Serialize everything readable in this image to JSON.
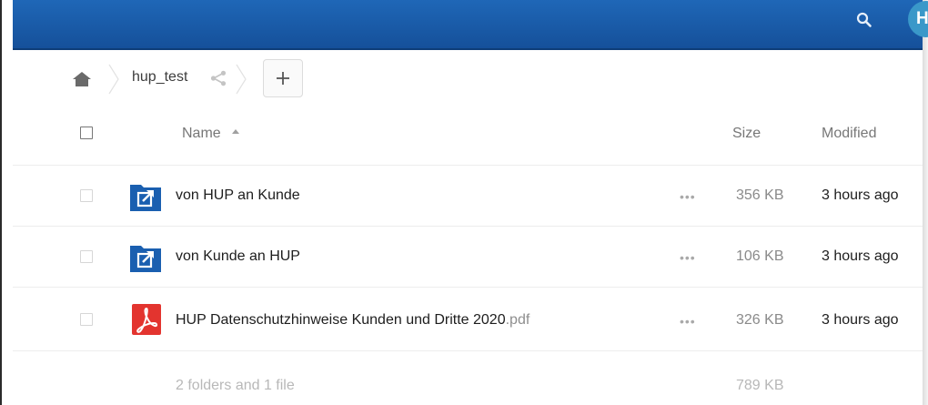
{
  "app": {
    "header_color": "#1a5ca8",
    "avatar_letter": "H",
    "avatar_color": "#3a98c9"
  },
  "icons": {
    "search": "search-icon",
    "home": "home-icon",
    "share": "share-icon",
    "add": "plus-icon",
    "shared_folder": "shared-folder-icon",
    "pdf": "pdf-file-icon",
    "more": "more-options-icon"
  },
  "breadcrumb": {
    "folder_name": "hup_test",
    "add_label": "+"
  },
  "table": {
    "columns": {
      "name": "Name",
      "size": "Size",
      "modified": "Modified"
    },
    "rows": [
      {
        "name": "von HUP an Kunde",
        "ext": "",
        "type": "shared-folder",
        "size": "356 KB",
        "modified": "3 hours ago",
        "more": "•••"
      },
      {
        "name": "von Kunde an HUP",
        "ext": "",
        "type": "shared-folder",
        "size": "106 KB",
        "modified": "3 hours ago",
        "more": "•••"
      },
      {
        "name": "HUP Datenschutzhinweise Kunden und Dritte 2020",
        "ext": ".pdf",
        "type": "pdf",
        "size": "326 KB",
        "modified": "3 hours ago",
        "more": "•••"
      }
    ],
    "summary": "2 folders and 1 file",
    "total_size": "789 KB"
  }
}
